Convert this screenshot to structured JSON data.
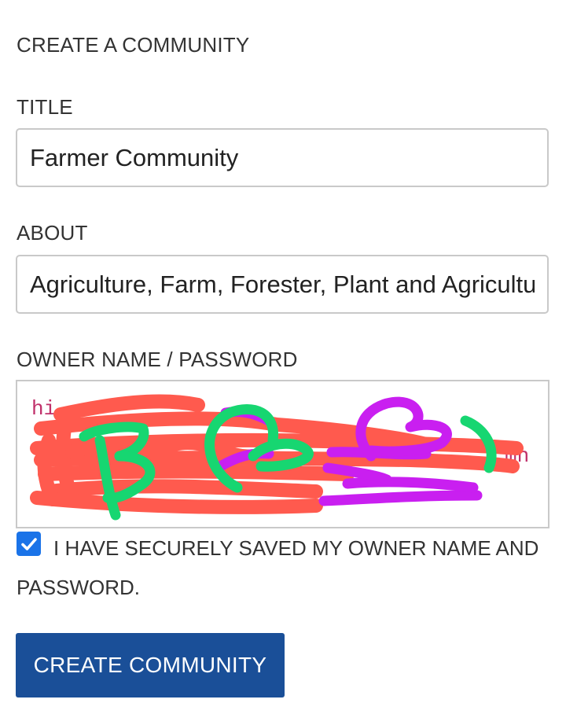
{
  "form": {
    "heading": "CREATE A COMMUNITY",
    "title": {
      "label": "TITLE",
      "value": "Farmer Community"
    },
    "about": {
      "label": "ABOUT",
      "value": "Agriculture, Farm, Forester, Plant and Agricultu"
    },
    "owner": {
      "label": "OWNER NAME / PASSWORD",
      "line1": "hi",
      "line2": "mn",
      "redacted": true
    },
    "confirm": {
      "checked": true,
      "text": "I HAVE SECURELY SAVED MY OWNER NAME AND PASSWORD."
    },
    "submit_label": "CREATE COMMUNITY"
  },
  "colors": {
    "accent": "#1a4f98",
    "checkbox": "#1a73e8",
    "scribble_red": "#ff5a4e",
    "scribble_green": "#17d671",
    "scribble_purple": "#c91ff0",
    "secret_text": "#c0306a"
  }
}
